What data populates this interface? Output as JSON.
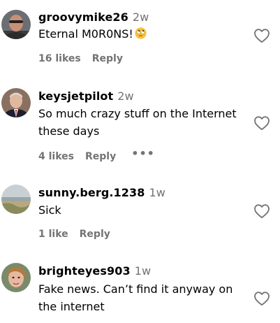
{
  "comments": [
    {
      "username": "groovymike26",
      "time": "2w",
      "text": "Eternal M0R0NS!",
      "emoji": "rolling-eyes-face",
      "likes": "16 likes",
      "reply": "Reply",
      "more": ""
    },
    {
      "username": "keysjetpilot",
      "time": "2w",
      "text": "So much crazy stuff on the Internet these days",
      "likes": "4 likes",
      "reply": "Reply",
      "more": "•••"
    },
    {
      "username": "sunny.berg.1238",
      "time": "1w",
      "text": "Sick",
      "likes": "1 like",
      "reply": "Reply",
      "more": ""
    },
    {
      "username": "brighteyes903",
      "time": "1w",
      "text": "Fake news. Can’t find it anyway on the internet",
      "likes": "",
      "reply": "",
      "more": ""
    }
  ],
  "colors": {
    "secondary_text": "#737373",
    "primary_text": "#000000",
    "heart_outline": "#737373"
  },
  "icons": {
    "like": "heart-outline-icon",
    "more": "more-options-icon"
  }
}
